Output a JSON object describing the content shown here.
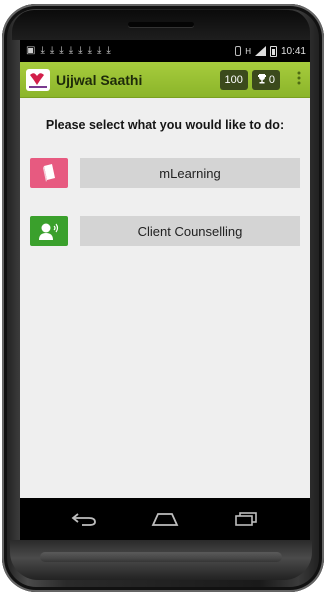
{
  "status_bar": {
    "notifications": [
      "▣",
      "⤓",
      "⤓",
      "⤓",
      "⤓",
      "⤓",
      "⤓",
      "⤓",
      "⤓"
    ],
    "network": "H",
    "time": "10:41"
  },
  "app_bar": {
    "title": "Ujjwal Saathi",
    "points": "100",
    "trophies": "0",
    "logo_icon": "ujjwal-saathi-logo",
    "trophy_icon": "trophy-icon",
    "overflow_icon": "overflow-menu-icon"
  },
  "main": {
    "prompt": "Please select what you would like to do:",
    "options": [
      {
        "label": "mLearning",
        "icon": "book-icon",
        "icon_color": "#e75a80"
      },
      {
        "label": "Client Counselling",
        "icon": "speaking-person-icon",
        "icon_color": "#3aa02c"
      }
    ]
  },
  "nav_bar": {
    "icons": [
      "back-icon",
      "home-icon",
      "recent-apps-icon"
    ]
  },
  "colors": {
    "app_bar": "#98bf33",
    "counter_bg": "#3b4a1c",
    "button_bg": "#d4d4d4",
    "screen_bg": "#efefef"
  }
}
